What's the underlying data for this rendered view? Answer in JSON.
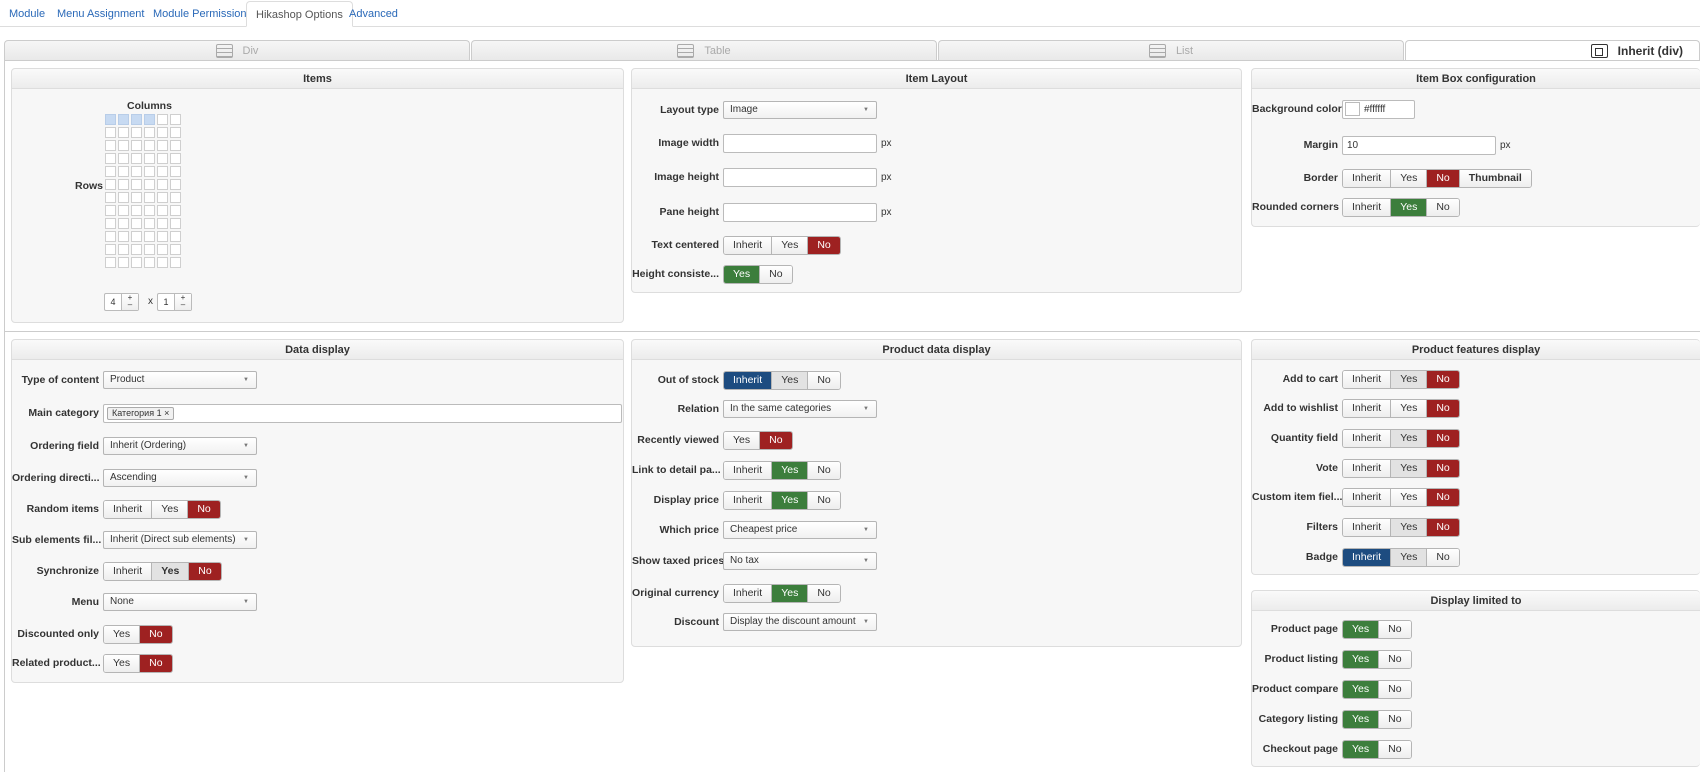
{
  "tabs": [
    "Module",
    "Menu Assignment",
    "Module Permissions",
    "Hikashop Options",
    "Advanced"
  ],
  "layout_tabs": [
    "Div",
    "Table",
    "List",
    "Inherit (div)"
  ],
  "items": {
    "title": "Items",
    "columns_label": "Columns",
    "rows_label": "Rows",
    "rows_value": "4",
    "times": "x",
    "cols_value": "1",
    "plus": "+",
    "minus": "–"
  },
  "item_layout": {
    "title": "Item Layout",
    "layout_type_label": "Layout type",
    "layout_type_value": "Image",
    "image_width_label": "Image width",
    "image_height_label": "Image height",
    "pane_height_label": "Pane height",
    "px": "px",
    "text_centered_label": "Text centered",
    "height_consistent_label": "Height consiste..."
  },
  "item_box": {
    "title": "Item Box configuration",
    "bg_color_label": "Background color",
    "bg_color_value": "#ffffff",
    "margin_label": "Margin",
    "margin_value": "10",
    "border_label": "Border",
    "rounded_label": "Rounded corners"
  },
  "data_display": {
    "title": "Data display",
    "type_label": "Type of content",
    "type_value": "Product",
    "category_label": "Main category",
    "category_tag": "Категория 1",
    "ordering_field_label": "Ordering field",
    "ordering_field_value": "Inherit (Ordering)",
    "ordering_dir_label": "Ordering directi...",
    "ordering_dir_value": "Ascending",
    "random_label": "Random items",
    "sub_label": "Sub elements fil...",
    "sub_value": "Inherit (Direct sub elements)",
    "sync_label": "Synchronize",
    "menu_label": "Menu",
    "menu_value": "None",
    "discounted_label": "Discounted only",
    "related_label": "Related product..."
  },
  "product_data": {
    "title": "Product data display",
    "out_of_stock_label": "Out of stock",
    "relation_label": "Relation",
    "relation_value": "In the same categories",
    "recently_label": "Recently viewed",
    "link_label": "Link to detail pa...",
    "display_price_label": "Display price",
    "which_price_label": "Which price",
    "which_price_value": "Cheapest price",
    "taxed_label": "Show taxed prices",
    "taxed_value": "No tax",
    "currency_label": "Original currency",
    "discount_label": "Discount",
    "discount_value": "Display the discount amount"
  },
  "features": {
    "title": "Product features display",
    "add_to_cart": "Add to cart",
    "add_to_wishlist": "Add to wishlist",
    "quantity_field": "Quantity field",
    "vote": "Vote",
    "custom_fields": "Custom item fiel...",
    "filters": "Filters",
    "badge": "Badge"
  },
  "limited": {
    "title": "Display limited to",
    "product_page": "Product page",
    "product_listing": "Product listing",
    "product_compare": "Product compare",
    "category_listing": "Category listing",
    "checkout_page": "Checkout page"
  },
  "btn": {
    "inherit": "Inherit",
    "yes": "Yes",
    "no": "No",
    "thumbnail": "Thumbnail",
    "remove": "×"
  },
  "colors": {
    "green": "#3c7e3c",
    "red": "#9e2121",
    "blue": "#1d4c80",
    "link": "#2a69b8"
  }
}
